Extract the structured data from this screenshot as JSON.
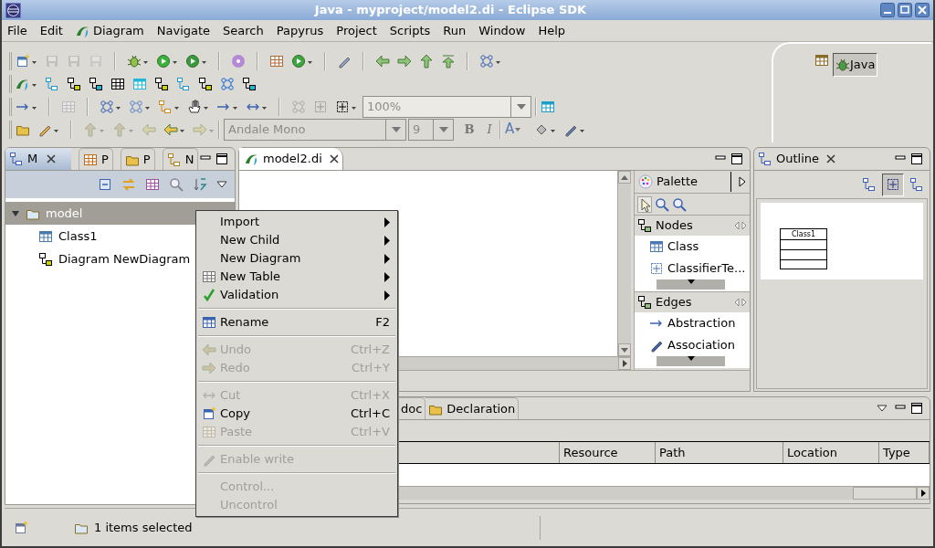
{
  "window": {
    "title": "Java - myproject/model2.di - Eclipse SDK"
  },
  "menu_bar": [
    {
      "label": "File"
    },
    {
      "label": "Edit"
    },
    {
      "label": "Diagram"
    },
    {
      "label": "Navigate"
    },
    {
      "label": "Search"
    },
    {
      "label": "Papyrus"
    },
    {
      "label": "Project"
    },
    {
      "label": "Scripts"
    },
    {
      "label": "Run"
    },
    {
      "label": "Window"
    },
    {
      "label": "Help"
    }
  ],
  "toolbar": {
    "zoom_combo": "100%",
    "font_combo": "Andale Mono",
    "size_combo": "9",
    "bold": "B",
    "italic": "I",
    "font_color": "A"
  },
  "perspectives": [
    {
      "label": "Java",
      "selected": true
    }
  ],
  "model_explorer": {
    "tabs": [
      {
        "label": "M",
        "selected": true
      },
      {
        "label": "P",
        "selected": false
      },
      {
        "label": "P",
        "selected": false
      },
      {
        "label": "N",
        "selected": false
      }
    ],
    "tree": [
      {
        "label": "model",
        "expanded": true,
        "selected": true,
        "children": [
          {
            "label": "Class1",
            "kind": "class"
          },
          {
            "label": "Diagram NewDiagram",
            "kind": "diagram"
          }
        ]
      }
    ]
  },
  "editor": {
    "tabs": [
      {
        "label": "model2.di",
        "selected": true
      }
    ],
    "palette": {
      "title": "Palette",
      "drawers": [
        {
          "label": "Nodes",
          "items": [
            {
              "label": "Class",
              "kind": "class"
            },
            {
              "label": "ClassifierTe...",
              "kind": "template"
            }
          ]
        },
        {
          "label": "Edges",
          "items": [
            {
              "label": "Abstraction",
              "kind": "abstraction"
            },
            {
              "label": "Association",
              "kind": "association"
            }
          ]
        }
      ]
    }
  },
  "outline": {
    "title": "Outline",
    "thumbnail_label": "Class1"
  },
  "bottom_panel": {
    "tabs": [
      {
        "label": "doc",
        "selected": false
      },
      {
        "label": "Declaration",
        "selected": false
      }
    ],
    "columns": [
      "Resource",
      "Path",
      "Location",
      "Type"
    ]
  },
  "context_menu": {
    "items": [
      {
        "kind": "item",
        "label": "Import",
        "submenu": true,
        "disabled": false
      },
      {
        "kind": "item",
        "label": "New Child",
        "submenu": true,
        "disabled": false
      },
      {
        "kind": "item",
        "label": "New Diagram",
        "submenu": true,
        "disabled": false
      },
      {
        "kind": "item",
        "label": "New Table",
        "submenu": true,
        "disabled": false
      },
      {
        "kind": "item",
        "label": "Validation",
        "submenu": true,
        "disabled": false
      },
      {
        "kind": "separator"
      },
      {
        "kind": "item",
        "label": "Rename",
        "shortcut": "F2",
        "disabled": false
      },
      {
        "kind": "separator"
      },
      {
        "kind": "item",
        "label": "Undo",
        "shortcut": "Ctrl+Z",
        "disabled": true
      },
      {
        "kind": "item",
        "label": "Redo",
        "shortcut": "Ctrl+Y",
        "disabled": true
      },
      {
        "kind": "separator"
      },
      {
        "kind": "item",
        "label": "Cut",
        "shortcut": "Ctrl+X",
        "disabled": true
      },
      {
        "kind": "item",
        "label": "Copy",
        "shortcut": "Ctrl+C",
        "disabled": false
      },
      {
        "kind": "item",
        "label": "Paste",
        "shortcut": "Ctrl+V",
        "disabled": true
      },
      {
        "kind": "separator"
      },
      {
        "kind": "item",
        "label": "Enable write",
        "disabled": true
      },
      {
        "kind": "separator"
      },
      {
        "kind": "item",
        "label": "Control...",
        "disabled": true
      },
      {
        "kind": "item",
        "label": "Uncontrol",
        "disabled": true
      }
    ]
  },
  "status_bar": {
    "text": "1 items selected"
  }
}
